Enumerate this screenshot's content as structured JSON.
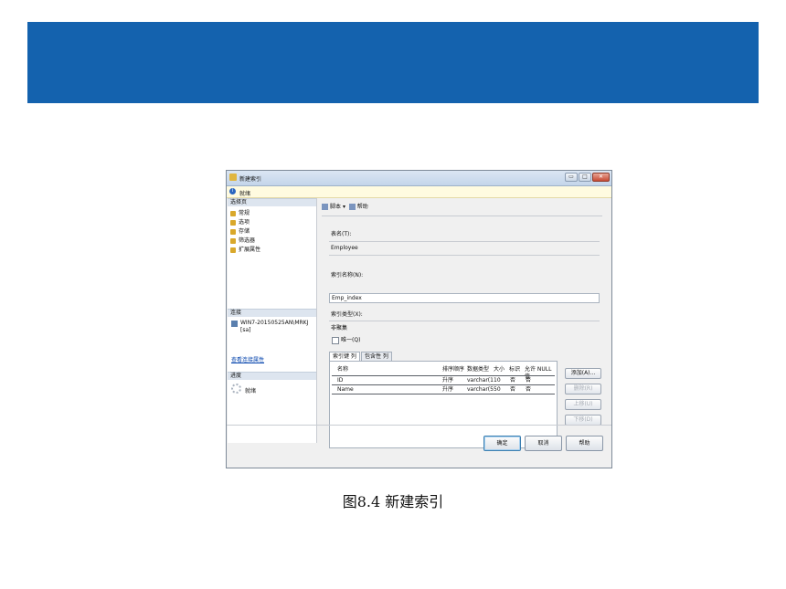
{
  "colors": {
    "banner": "#1462ae",
    "status_bg": "#fffbe0",
    "link": "#0645ad"
  },
  "dialog": {
    "title": "新建索引",
    "window_buttons": {
      "minimize": "▭",
      "maximize": "□",
      "close": "✕"
    },
    "status": "就绪",
    "left": {
      "select_page_heading": "选择页",
      "pages": [
        "常规",
        "选项",
        "存储",
        "筛选器",
        "扩展属性"
      ],
      "connection_heading": "连接",
      "server": "WIN7-20150525AN\\MRKJ",
      "user": "[sa]",
      "view_connection_link": "查看连接属性",
      "progress_heading": "进度",
      "progress_status": "就绪"
    },
    "toolbar": {
      "script": "脚本",
      "dropdown": "▾",
      "help": "帮助"
    },
    "form": {
      "table_name_label": "表名(T):",
      "table_name_value": "Employee",
      "index_name_label": "索引名称(N):",
      "index_name_value": "Emp_index",
      "index_type_label": "索引类型(X):",
      "index_type_value": "非聚集",
      "unique_label": "唯一(Q)",
      "unique_checked": false
    },
    "tabs": [
      "索引键 列",
      "包含性 列"
    ],
    "table": {
      "headers": [
        "名称",
        "排序顺序",
        "数据类型",
        "大小",
        "标识",
        "允许 NULL 值"
      ],
      "rows": [
        [
          "ID",
          "升序",
          "varchar(1",
          "10",
          "否",
          "否"
        ],
        [
          "Name",
          "升序",
          "varchar(5",
          "50",
          "否",
          "否"
        ]
      ]
    },
    "side_buttons": {
      "add": "添加(A)...",
      "remove": "删除(R)",
      "move_up": "上移(U)",
      "move_down": "下移(D)"
    },
    "footer_buttons": {
      "ok": "确定",
      "cancel": "取消",
      "help": "帮助"
    }
  },
  "caption": "图8.4  新建索引"
}
